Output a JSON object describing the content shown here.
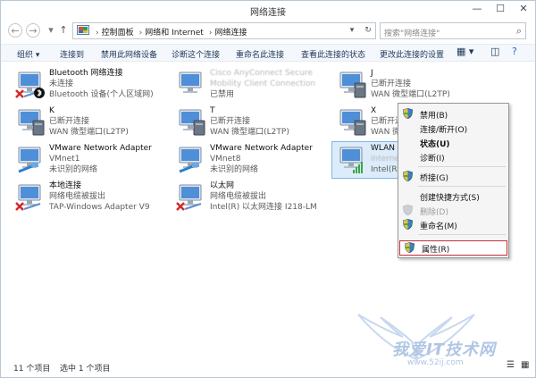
{
  "window": {
    "title": "网络连接"
  },
  "address": {
    "crumbs": [
      "控制面板",
      "网络和 Internet",
      "网络连接"
    ],
    "search_placeholder": "搜索\"网络连接\""
  },
  "toolbar": {
    "organize": "组织 ▾",
    "connect_to": "连接到",
    "disable_device": "禁用此网络设备",
    "diagnose": "诊断这个连接",
    "rename": "重命名此连接",
    "view_status": "查看此连接的状态",
    "change_settings": "更改此连接的设置"
  },
  "connections": [
    {
      "name": "Bluetooth 网络连接",
      "status": "未连接",
      "device": "Bluetooth 设备(个人区域网)",
      "badge": "x-bluetooth"
    },
    {
      "name": "Cisco AnyConnect Secure",
      "status": "Mobility Client Connection",
      "device": "已禁用",
      "blurred": true
    },
    {
      "name": "J",
      "status": "已断开连接",
      "device": "WAN 微型端口(L2TP)"
    },
    {
      "name": "K",
      "status": "已断开连接",
      "device": "WAN 微型端口(L2TP)"
    },
    {
      "name": "T",
      "status": "已断开连接",
      "device": "WAN 微型端口(L2TP)"
    },
    {
      "name": "X",
      "status": "已断开连接",
      "device": "WAN 微型端口(L2TP)"
    },
    {
      "name": "VMware Network Adapter",
      "status": "VMnet1",
      "device": "未识别的网络"
    },
    {
      "name": "VMware Network Adapter",
      "status": "VMnet8",
      "device": "未识别的网络"
    },
    {
      "name": "WLAN",
      "status": "internet.baidu.com",
      "device": "Intel(R)"
    },
    {
      "name": "本地连接",
      "status": "网络电缆被拔出",
      "device": "TAP-Windows Adapter V9",
      "badge": "x"
    },
    {
      "name": "以太网",
      "status": "网络电缆被拔出",
      "device": "Intel(R) 以太网连接 I218-LM",
      "badge": "x"
    }
  ],
  "context_menu": {
    "items": [
      {
        "label": "禁用(B)",
        "shield": true
      },
      {
        "label": "连接/断开(O)"
      },
      {
        "label": "状态(U)",
        "bold": true
      },
      {
        "label": "诊断(I)"
      },
      {
        "label": "桥接(G)",
        "shield": true
      },
      {
        "label": "创建快捷方式(S)"
      },
      {
        "label": "删除(D)",
        "shield": true,
        "disabled": true
      },
      {
        "label": "重命名(M)",
        "shield": true
      },
      {
        "label": "属性(R)",
        "shield": true,
        "highlighted": true
      }
    ]
  },
  "status": {
    "count": "11 个项目",
    "selected": "选中 1 个项目"
  },
  "watermark": {
    "text": "我爱IT技术网",
    "url": "www.52ij.com"
  }
}
